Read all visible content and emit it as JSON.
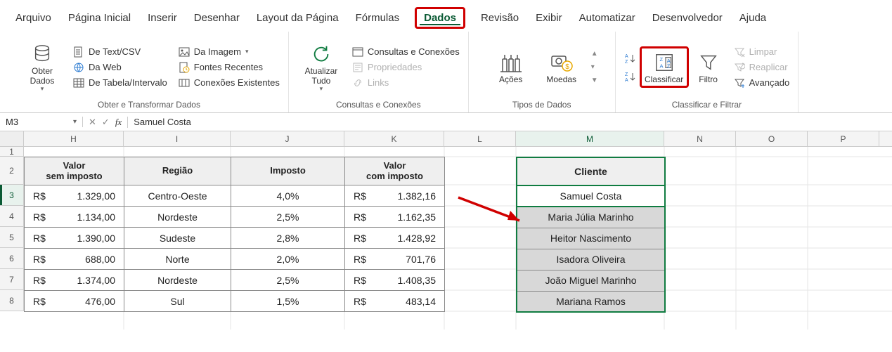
{
  "tabs": {
    "arquivo": "Arquivo",
    "pagina_inicial": "Página Inicial",
    "inserir": "Inserir",
    "desenhar": "Desenhar",
    "layout": "Layout da Página",
    "formulas": "Fórmulas",
    "dados": "Dados",
    "revisao": "Revisão",
    "exibir": "Exibir",
    "automatizar": "Automatizar",
    "desenvolvedor": "Desenvolvedor",
    "ajuda": "Ajuda"
  },
  "ribbon": {
    "obter_dados": "Obter\nDados",
    "text_csv": "De Text/CSV",
    "da_web": "Da Web",
    "tabela_intervalo": "De Tabela/Intervalo",
    "da_imagem": "Da Imagem",
    "fontes_recentes": "Fontes Recentes",
    "conexoes": "Conexões Existentes",
    "group_obter": "Obter e Transformar Dados",
    "atualizar_tudo": "Atualizar\nTudo",
    "consultas_conexoes": "Consultas e Conexões",
    "propriedades": "Propriedades",
    "links": "Links",
    "group_consultas": "Consultas e Conexões",
    "acoes": "Ações",
    "moedas": "Moedas",
    "group_tipos": "Tipos de Dados",
    "classificar": "Classificar",
    "filtro": "Filtro",
    "limpar": "Limpar",
    "reaplicar": "Reaplicar",
    "avancado": "Avançado",
    "group_classificar": "Classificar e Filtrar"
  },
  "namebox": {
    "value": "M3"
  },
  "formula": {
    "value": "Samuel Costa"
  },
  "col_labels": [
    "H",
    "I",
    "J",
    "K",
    "L",
    "M",
    "N",
    "O",
    "P"
  ],
  "row_labels": [
    "1",
    "2",
    "3",
    "4",
    "5",
    "6",
    "7",
    "8"
  ],
  "table_headers": {
    "valor_sem": "Valor\nsem imposto",
    "regiao": "Região",
    "imposto": "Imposto",
    "valor_com": "Valor\ncom imposto"
  },
  "table_rows": [
    {
      "rs1": "R$",
      "v1": "1.329,00",
      "regiao": "Centro-Oeste",
      "imposto": "4,0%",
      "rs2": "R$",
      "v2": "1.382,16"
    },
    {
      "rs1": "R$",
      "v1": "1.134,00",
      "regiao": "Nordeste",
      "imposto": "2,5%",
      "rs2": "R$",
      "v2": "1.162,35"
    },
    {
      "rs1": "R$",
      "v1": "1.390,00",
      "regiao": "Sudeste",
      "imposto": "2,8%",
      "rs2": "R$",
      "v2": "1.428,92"
    },
    {
      "rs1": "R$",
      "v1": "688,00",
      "regiao": "Norte",
      "imposto": "2,0%",
      "rs2": "R$",
      "v2": "701,76"
    },
    {
      "rs1": "R$",
      "v1": "1.374,00",
      "regiao": "Nordeste",
      "imposto": "2,5%",
      "rs2": "R$",
      "v2": "1.408,35"
    },
    {
      "rs1": "R$",
      "v1": "476,00",
      "regiao": "Sul",
      "imposto": "1,5%",
      "rs2": "R$",
      "v2": "483,14"
    }
  ],
  "cliente_header": "Cliente",
  "clientes": [
    "Samuel Costa",
    "Maria Júlia Marinho",
    "Heitor Nascimento",
    "Isadora Oliveira",
    "João Miguel Marinho",
    "Mariana Ramos"
  ],
  "chart_data": {
    "type": "table",
    "title": "Valores com e sem imposto por região",
    "columns": [
      "Valor sem imposto (R$)",
      "Região",
      "Imposto (%)",
      "Valor com imposto (R$)"
    ],
    "rows": [
      [
        1329.0,
        "Centro-Oeste",
        4.0,
        1382.16
      ],
      [
        1134.0,
        "Nordeste",
        2.5,
        1162.35
      ],
      [
        1390.0,
        "Sudeste",
        2.8,
        1428.92
      ],
      [
        688.0,
        "Norte",
        2.0,
        701.76
      ],
      [
        1374.0,
        "Nordeste",
        2.5,
        1408.35
      ],
      [
        476.0,
        "Sul",
        1.5,
        483.14
      ]
    ],
    "cliente_list": [
      "Samuel Costa",
      "Maria Júlia Marinho",
      "Heitor Nascimento",
      "Isadora Oliveira",
      "João Miguel Marinho",
      "Mariana Ramos"
    ]
  }
}
